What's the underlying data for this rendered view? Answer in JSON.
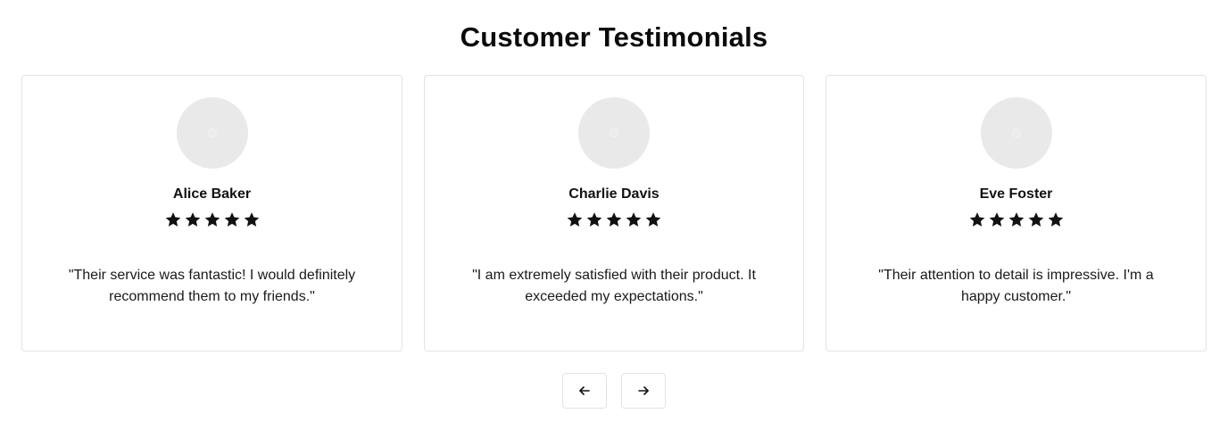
{
  "page": {
    "title": "Customer Testimonials"
  },
  "testimonials": [
    {
      "name": "Alice Baker",
      "rating": 5,
      "quote": "\"Their service was fantastic! I would definitely recommend them to my friends.\""
    },
    {
      "name": "Charlie Davis",
      "rating": 5,
      "quote": "\"I am extremely satisfied with their product. It exceeded my expectations.\""
    },
    {
      "name": "Eve Foster",
      "rating": 5,
      "quote": "\"Their attention to detail is impressive. I'm a happy customer.\""
    }
  ],
  "navigation": {
    "prev_icon": "arrow-left-icon",
    "next_icon": "arrow-right-icon"
  },
  "colors": {
    "text": "#111111",
    "border": "#e3e3e3",
    "avatar_placeholder": "#e9e9e9",
    "star": "#111111"
  },
  "icons": {
    "star": "star-icon",
    "avatar": "user-avatar-placeholder"
  }
}
